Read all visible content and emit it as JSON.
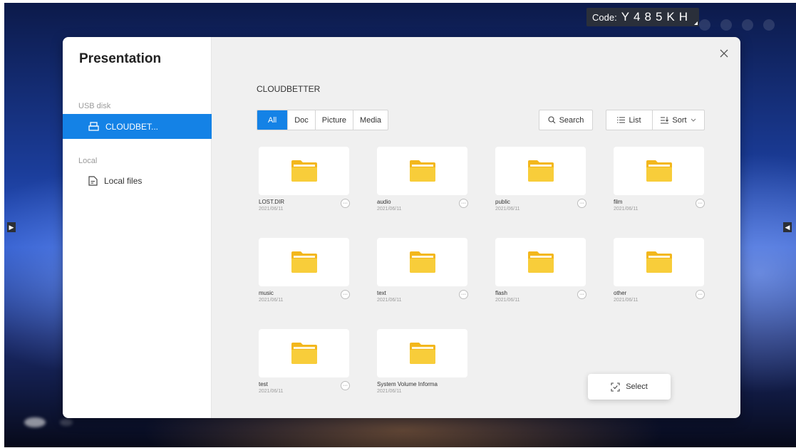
{
  "overlay": {
    "code_label": "Code:",
    "code_value": "Y485KH"
  },
  "sidebar": {
    "title": "Presentation",
    "sections": [
      {
        "label": "USB disk",
        "items": [
          {
            "label": "CLOUDBET...",
            "icon": "usb-drive-icon",
            "active": true
          }
        ]
      },
      {
        "label": "Local",
        "items": [
          {
            "label": "Local files",
            "icon": "document-icon",
            "active": false
          }
        ]
      }
    ]
  },
  "main": {
    "breadcrumb": "CLOUDBETTER",
    "tabs": [
      {
        "label": "All",
        "active": true
      },
      {
        "label": "Doc",
        "active": false
      },
      {
        "label": "Picture",
        "active": false
      },
      {
        "label": "Media",
        "active": false
      }
    ],
    "search_label": "Search",
    "list_label": "List",
    "sort_label": "Sort",
    "files": [
      {
        "name": "LOST.DIR",
        "date": "2021/06/11"
      },
      {
        "name": "audio",
        "date": "2021/06/11"
      },
      {
        "name": "public",
        "date": "2021/06/11"
      },
      {
        "name": "film",
        "date": "2021/06/11"
      },
      {
        "name": "music",
        "date": "2021/06/11"
      },
      {
        "name": "text",
        "date": "2021/06/11"
      },
      {
        "name": "flash",
        "date": "2021/06/11"
      },
      {
        "name": "other",
        "date": "2021/06/11"
      },
      {
        "name": "test",
        "date": "2021/06/11"
      },
      {
        "name": "System Volume Informa",
        "date": "2021/06/11"
      }
    ],
    "popup_label": "Select"
  },
  "colors": {
    "accent": "#1482e6",
    "folder": "#f7c532",
    "panel_bg": "#f0f0f0"
  }
}
